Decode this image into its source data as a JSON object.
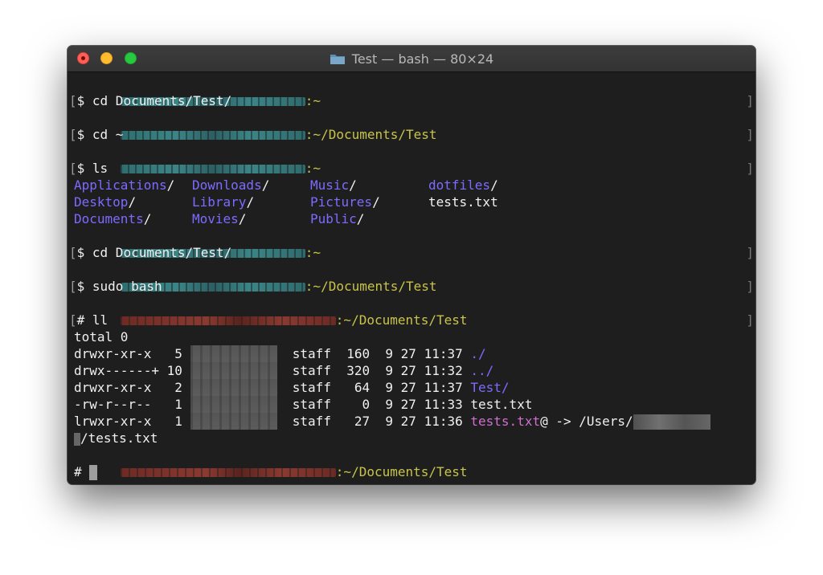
{
  "window": {
    "title": "Test — bash — 80×24"
  },
  "terminal": {
    "lines": [
      {
        "kind": "user-prompt",
        "path": ":~"
      },
      {
        "kind": "cmd",
        "prefix": "$ ",
        "text": "cd Documents/Test/"
      },
      {
        "kind": "user-prompt",
        "path": ":~/Documents/Test"
      },
      {
        "kind": "cmd",
        "prefix": "$ ",
        "text": "cd ~"
      },
      {
        "kind": "user-prompt",
        "path": ":~"
      },
      {
        "kind": "cmd",
        "prefix": "$ ",
        "text": "ls"
      }
    ],
    "ls_grid": [
      [
        {
          "name": "Applications",
          "suffix": "/"
        },
        {
          "name": "Downloads",
          "suffix": "/"
        },
        {
          "name": "Music",
          "suffix": "/"
        },
        {
          "name": "dotfiles",
          "suffix": "/"
        }
      ],
      [
        {
          "name": "Desktop",
          "suffix": "/"
        },
        {
          "name": "Library",
          "suffix": "/"
        },
        {
          "name": "Pictures",
          "suffix": "/"
        },
        {
          "name": "tests.txt",
          "suffix": ""
        }
      ],
      [
        {
          "name": "Documents",
          "suffix": "/"
        },
        {
          "name": "Movies",
          "suffix": "/"
        },
        {
          "name": "Public",
          "suffix": "/"
        }
      ]
    ],
    "prompt_home": ":~",
    "cmd_cd_test": "cd Documents/Test/",
    "prompt_test": ":~/Documents/Test",
    "cmd_sudo": "sudo bash",
    "root_prompt": ":~/Documents/Test",
    "cmd_ll": "ll",
    "total": "total 0",
    "ll_rows": [
      {
        "perms": "drwxr-xr-x",
        "links": "5",
        "group": "staff",
        "size": "160",
        "month": "9",
        "day": "27",
        "time": "11:37",
        "name": "./",
        "name_color": "blue"
      },
      {
        "perms": "drwx------+",
        "links": "10",
        "group": "staff",
        "size": "320",
        "month": "9",
        "day": "27",
        "time": "11:32",
        "name": "../",
        "name_color": "blue"
      },
      {
        "perms": "drwxr-xr-x",
        "links": "2",
        "group": "staff",
        "size": "64",
        "month": "9",
        "day": "27",
        "time": "11:37",
        "name": "Test/",
        "name_color": "blue"
      },
      {
        "perms": "-rw-r--r--",
        "links": "1",
        "group": "staff",
        "size": "0",
        "month": "9",
        "day": "27",
        "time": "11:33",
        "name": "test.txt",
        "name_color": "white"
      },
      {
        "perms": "lrwxr-xr-x",
        "links": "1",
        "group": "staff",
        "size": "27",
        "month": "9",
        "day": "27",
        "time": "11:36",
        "name": "tests.txt",
        "name_color": "magenta"
      }
    ],
    "symlink_arrow": "@ -> /Users/",
    "symlink_tail": "/tests.txt",
    "final_prompt_path": ":~/Documents/Test",
    "final_prompt_symbol": "# "
  },
  "colors": {
    "background": "#1e1e1e",
    "prompt_path": "#c9c34a",
    "directory": "#7d6bff",
    "symlink": "#d06fd0"
  }
}
